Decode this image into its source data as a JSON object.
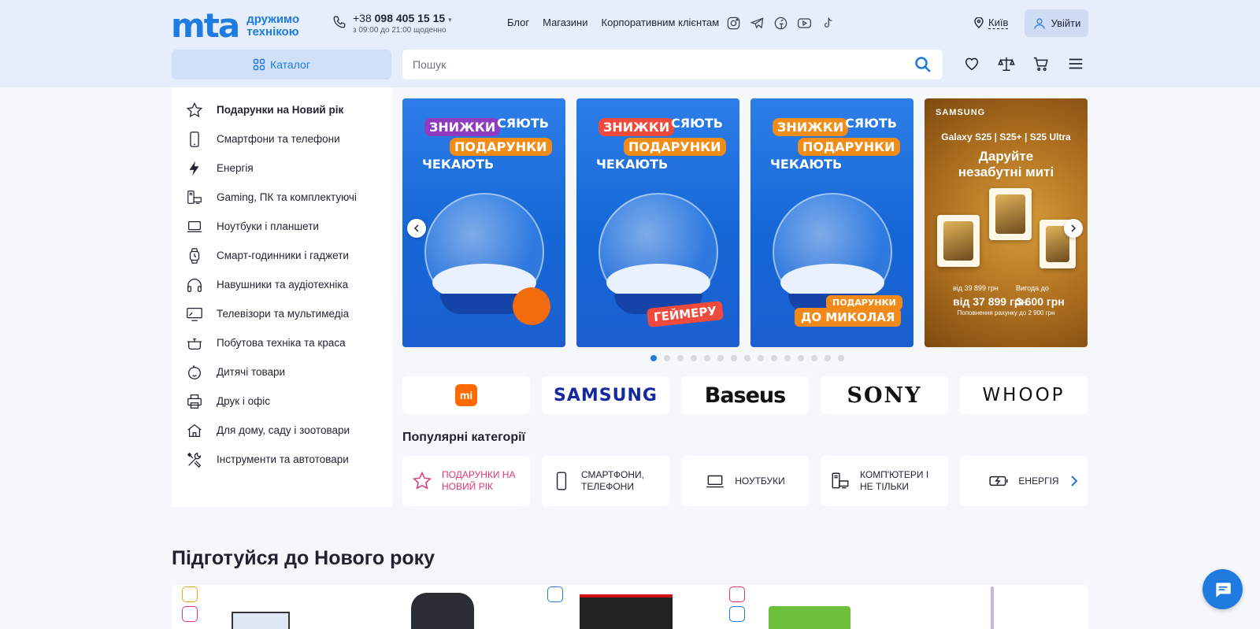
{
  "header": {
    "logo": {
      "mark": "mta",
      "tagline": "дружимо технікою"
    },
    "phone": {
      "prefix": "+38",
      "number": "098 405 15 15",
      "hours": "з 09:00 до 21:00 щоденно"
    },
    "nav": [
      "Блог",
      "Магазини",
      "Корпоративним клієнтам"
    ],
    "social_icons": [
      "instagram-icon",
      "telegram-icon",
      "facebook-icon",
      "youtube-icon",
      "tiktok-icon"
    ],
    "city": "Київ",
    "login_label": "Увійти",
    "catalog_label": "Каталог",
    "search_placeholder": "Пошук",
    "action_icons": [
      "heart-icon",
      "compare-icon",
      "cart-icon",
      "menu-icon"
    ]
  },
  "sidebar": {
    "items": [
      {
        "label": "Подарунки на Новий рік",
        "icon": "star-icon"
      },
      {
        "label": "Смартфони та телефони",
        "icon": "smartphone-icon"
      },
      {
        "label": "Енергія",
        "icon": "lightning-icon"
      },
      {
        "label": "Gaming, ПК та комплектуючі",
        "icon": "pc-icon"
      },
      {
        "label": "Ноутбуки і планшети",
        "icon": "laptop-icon"
      },
      {
        "label": "Смарт-годинники і гаджети",
        "icon": "watch-icon"
      },
      {
        "label": "Навушники та аудіотехніка",
        "icon": "headphones-icon"
      },
      {
        "label": "Телевізори та мультимедіа",
        "icon": "tv-icon"
      },
      {
        "label": "Побутова техніка та краса",
        "icon": "pot-icon"
      },
      {
        "label": "Дитячі товари",
        "icon": "baby-icon"
      },
      {
        "label": "Друк і офіс",
        "icon": "printer-icon"
      },
      {
        "label": "Для дому, саду і зоотовари",
        "icon": "home-icon"
      },
      {
        "label": "Інструменти та автотовари",
        "icon": "tools-icon"
      }
    ]
  },
  "banners": [
    {
      "tag1": "ЗНИЖКИ",
      "word1": "СЯЮТЬ",
      "tag2": "ПОДАРУНКИ",
      "word2": "ЧЕКАЮТЬ",
      "ribbon": ""
    },
    {
      "tag1": "ЗНИЖКИ",
      "word1": "СЯЮТЬ",
      "tag2": "ПОДАРУНКИ",
      "word2": "ЧЕКАЮТЬ",
      "ribbon": "ГЕЙМЕРУ"
    },
    {
      "tag1": "ЗНИЖКИ",
      "word1": "СЯЮТЬ",
      "tag2": "ПОДАРУНКИ",
      "word2": "ЧЕКАЮТЬ",
      "ribbon_small": "ПОДАРУНКИ",
      "ribbon": "ДО МИКОЛАЯ"
    },
    {
      "brand": "SAMSUNG",
      "models": "Galaxy S25 | S25+ | S25 Ultra",
      "slogan": "Даруйте незабутні миті",
      "old_price": "від 39 899 грн",
      "new_price": "від 37 899 грн",
      "benefit_label": "Вигода до",
      "benefit": "3 600 грн",
      "note": "Поповнення рахунку до 2 900 грн"
    }
  ],
  "carousel": {
    "slides_total": 15,
    "active_slide": 1
  },
  "brands": [
    "mi",
    "SAMSUNG",
    "Baseus",
    "SONY",
    "WHOOP"
  ],
  "popular": {
    "title": "Популярні категорії",
    "items": [
      {
        "label": "ПОДАРУНКИ НА НОВИЙ РІК",
        "icon": "star-icon"
      },
      {
        "label": "СМАРТФОНИ, ТЕЛЕФОНИ",
        "icon": "smartphone-icon"
      },
      {
        "label": "НОУТБУКИ",
        "icon": "laptop-icon"
      },
      {
        "label": "КОМП'ЮТЕРИ І НЕ ТІЛЬКИ",
        "icon": "pc-icon"
      },
      {
        "label": "ЕНЕРГІЯ",
        "icon": "battery-icon"
      }
    ]
  },
  "section": {
    "title": "Підготуйся до Нового року"
  },
  "colors": {
    "accent": "#1f7be0",
    "header_bg": "#e6eefb",
    "page_bg": "#f5f7fa",
    "gift_pink": "#e0357a"
  }
}
